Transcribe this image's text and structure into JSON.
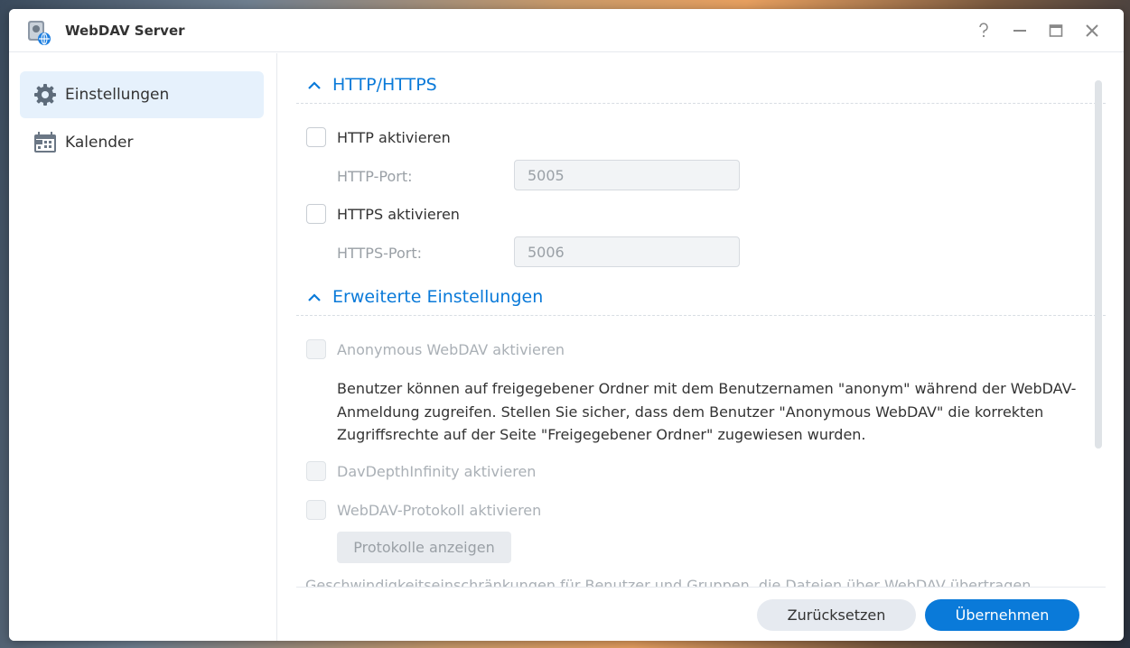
{
  "window": {
    "title": "WebDAV Server",
    "controls": [
      "help-icon",
      "minimize-icon",
      "maximize-icon",
      "close-icon"
    ]
  },
  "sidebar": {
    "items": [
      {
        "label": "Einstellungen",
        "icon": "gear-icon",
        "active": true
      },
      {
        "label": "Kalender",
        "icon": "calendar-icon",
        "active": false
      }
    ]
  },
  "main": {
    "http_section": {
      "title": "HTTP/HTTPS",
      "http_enable_label": "HTTP aktivieren",
      "http_enabled": false,
      "http_port_label": "HTTP-Port:",
      "http_port_value": "5005",
      "https_enable_label": "HTTPS aktivieren",
      "https_enabled": false,
      "https_port_label": "HTTPS-Port:",
      "https_port_value": "5006"
    },
    "advanced_section": {
      "title": "Erweiterte Einstellungen",
      "anonymous_label": "Anonymous WebDAV aktivieren",
      "description_lines": [
        "Benutzer können auf freigegebener Ordner mit dem Benutzernamen \"anonym\" während der WebDAV-",
        "Anmeldung zugreifen. Stellen Sie sicher, dass dem Benutzer \"Anonymous WebDAV\" die korrekten",
        "Zugriffsrechte auf der Seite \"Freigegebener Ordner\" zugewiesen wurden."
      ],
      "depth_infinity_label": "DavDepthInfinity aktivieren",
      "protocol_label": "WebDAV-Protokoll aktivieren",
      "show_logs_button": "Protokolle anzeigen",
      "speed_limit_text": "Geschwindigkeitseinschränkungen für Benutzer und Gruppen, die Dateien über WebDAV übertragen,"
    }
  },
  "footer": {
    "reset_label": "Zurücksetzen",
    "apply_label": "Übernehmen"
  },
  "colors": {
    "accent": "#0a7ad9",
    "active_bg": "#e6f1fc"
  }
}
